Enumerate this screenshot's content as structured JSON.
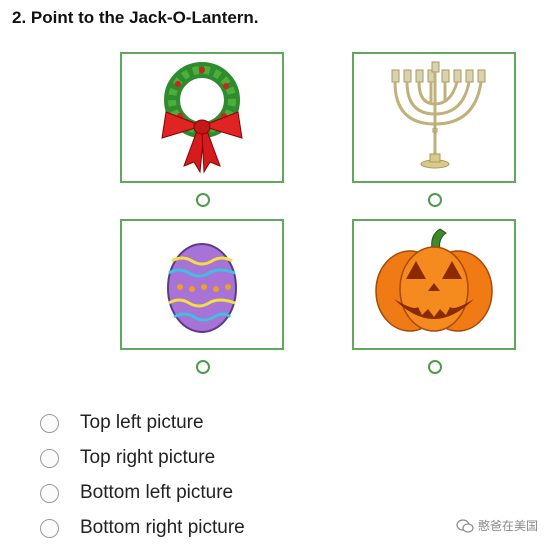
{
  "question": {
    "title": "2. Point to the Jack-O-Lantern."
  },
  "pictures": [
    {
      "icon": "wreath-icon"
    },
    {
      "icon": "menorah-icon"
    },
    {
      "icon": "easter-egg-icon"
    },
    {
      "icon": "jack-o-lantern-icon"
    }
  ],
  "options": [
    {
      "label": "Top left picture"
    },
    {
      "label": "Top right picture"
    },
    {
      "label": "Bottom left picture"
    },
    {
      "label": "Bottom right picture"
    }
  ],
  "watermark": {
    "text": "憨爸在美国"
  },
  "colors": {
    "box_border": "#5fa85c",
    "radio_border": "#4e9a4a"
  }
}
